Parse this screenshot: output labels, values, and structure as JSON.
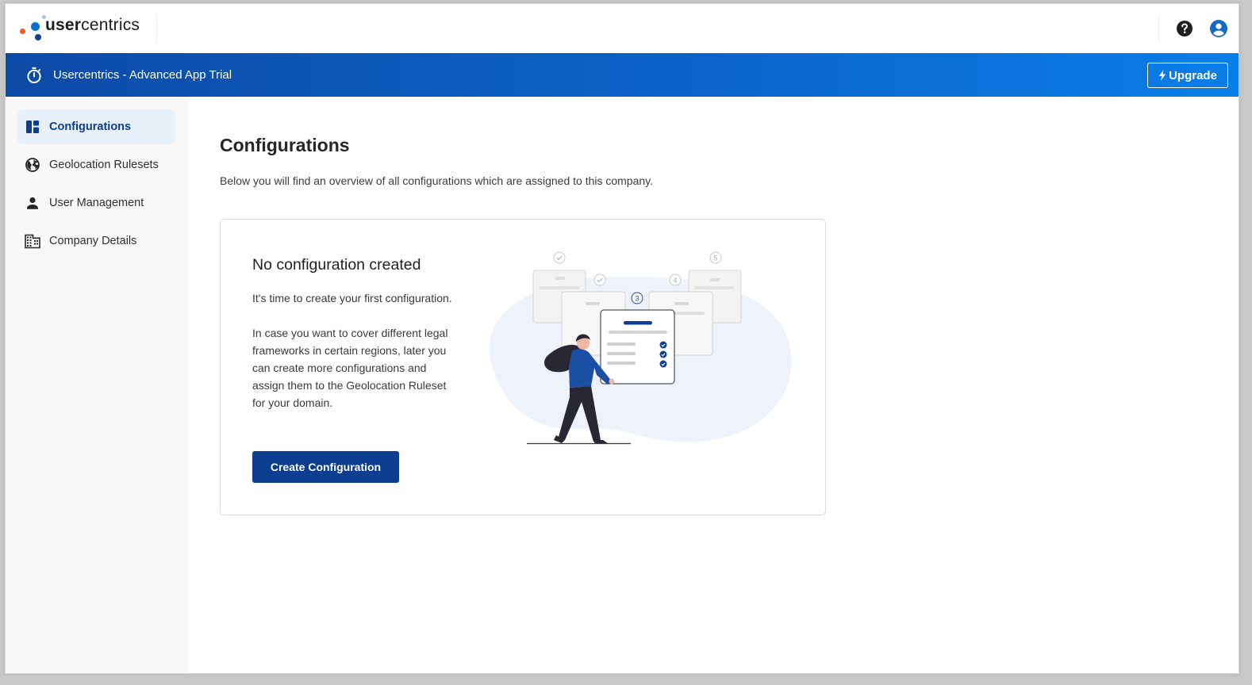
{
  "header": {
    "logo_text_bold": "user",
    "logo_text_light": "centrics",
    "help_icon": "help-circle-icon",
    "account_icon": "account-circle-icon"
  },
  "banner": {
    "icon": "timer-icon",
    "title": "Usercentrics - Advanced App Trial",
    "upgrade_label": "Upgrade",
    "upgrade_icon": "lightning-icon"
  },
  "sidebar": {
    "items": [
      {
        "label": "Configurations",
        "icon": "dashboard-icon",
        "active": true
      },
      {
        "label": "Geolocation Rulesets",
        "icon": "globe-icon",
        "active": false
      },
      {
        "label": "User Management",
        "icon": "person-icon",
        "active": false
      },
      {
        "label": "Company Details",
        "icon": "building-icon",
        "active": false
      }
    ]
  },
  "main": {
    "title": "Configurations",
    "description": "Below you will find an overview of all configurations which are assigned to this company.",
    "empty_state": {
      "title": "No configuration created",
      "paragraph1": "It's time to create your first configuration.",
      "paragraph2": "In case you want to cover different legal frameworks in certain regions, later you can create more configurations and assign them to the Geolocation Ruleset for your domain.",
      "button_label": "Create Configuration",
      "illustration_steps": [
        "3",
        "4",
        "5"
      ]
    }
  },
  "colors": {
    "brand_dark_blue": "#0b3d91",
    "banner_start": "#0c4aa6",
    "banner_end": "#0a7ee8",
    "active_nav_bg": "#e8f0fa",
    "logo_orange": "#f05a22"
  }
}
